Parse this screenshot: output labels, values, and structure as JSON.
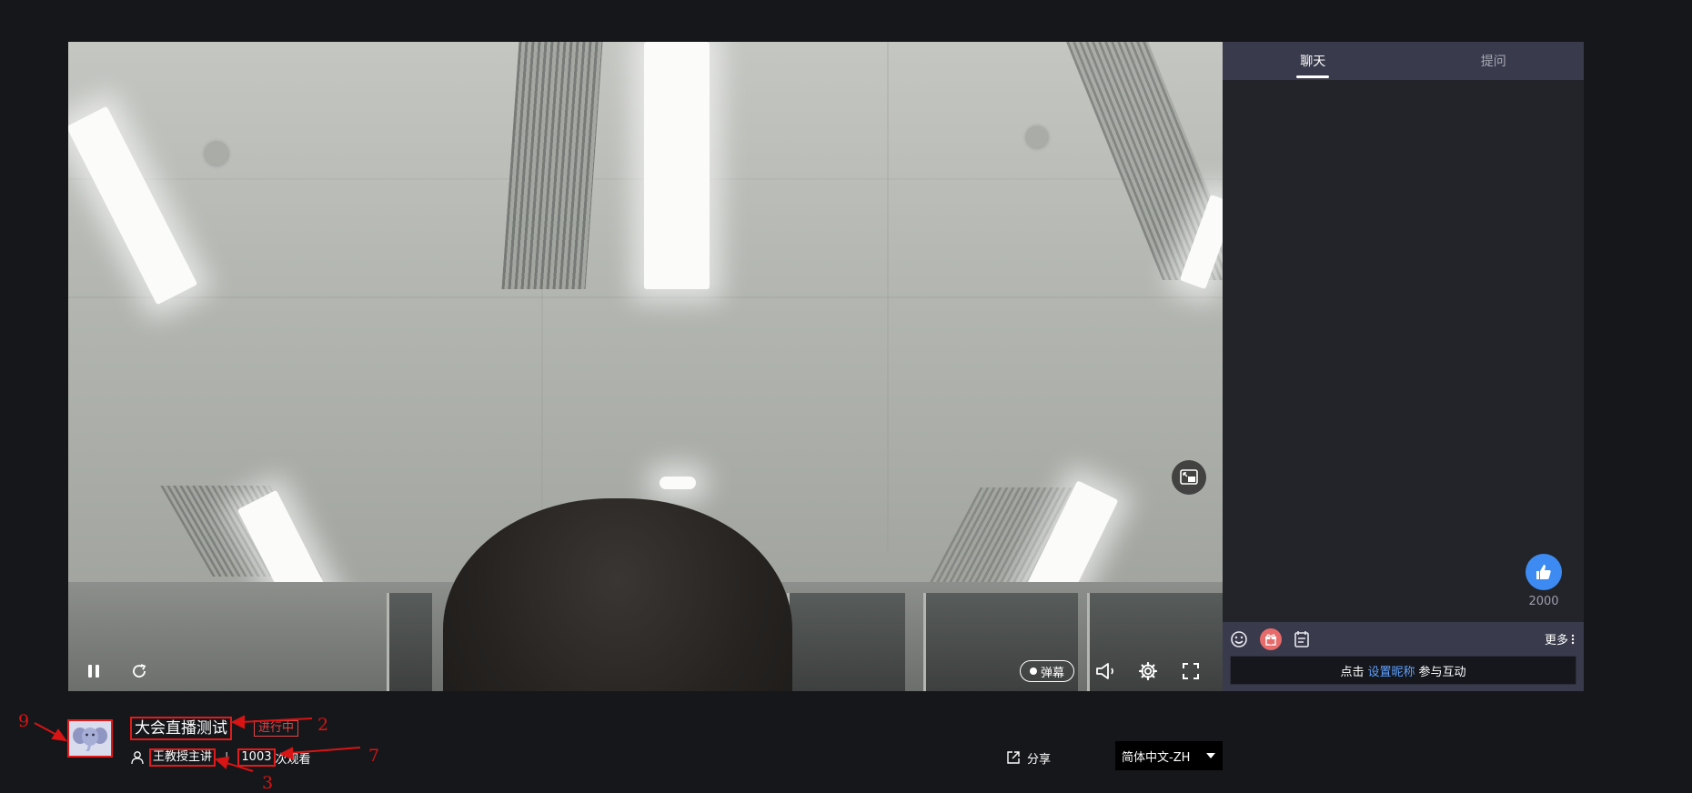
{
  "player": {
    "danmu_label": "弹幕",
    "icons": {
      "pause": "pause-icon",
      "refresh": "refresh-icon",
      "volume": "volume-icon",
      "settings": "gear-icon",
      "fullscreen": "fullscreen-icon",
      "pip": "picture-in-picture-icon"
    }
  },
  "side_panel": {
    "tabs": [
      {
        "label": "聊天",
        "active": true
      },
      {
        "label": "提问",
        "active": false
      }
    ],
    "like_count": "2000",
    "more_label": "更多",
    "nickname_prompt": {
      "prefix": "点击",
      "link": "设置昵称",
      "suffix": "参与互动"
    },
    "tools": [
      "emoji-icon",
      "gift-icon",
      "notice-icon"
    ]
  },
  "stream_info": {
    "title": "大会直播测试",
    "status": "进行中",
    "host": "王教授主讲",
    "view_count": "1003",
    "view_suffix": "次观看",
    "share_label": "分享",
    "language": "简体中文-ZH"
  },
  "annotations": {
    "avatar": "9",
    "title": "2",
    "host": "3",
    "views": "7"
  },
  "colors": {
    "page_bg": "#16171b",
    "panel_bg": "#23242a",
    "tab_bar": "#393a4c",
    "annotation_red": "#e11b1b",
    "link_blue": "#5da0ff",
    "like_blue": "#3d8bf2",
    "status_red": "#e04545"
  }
}
